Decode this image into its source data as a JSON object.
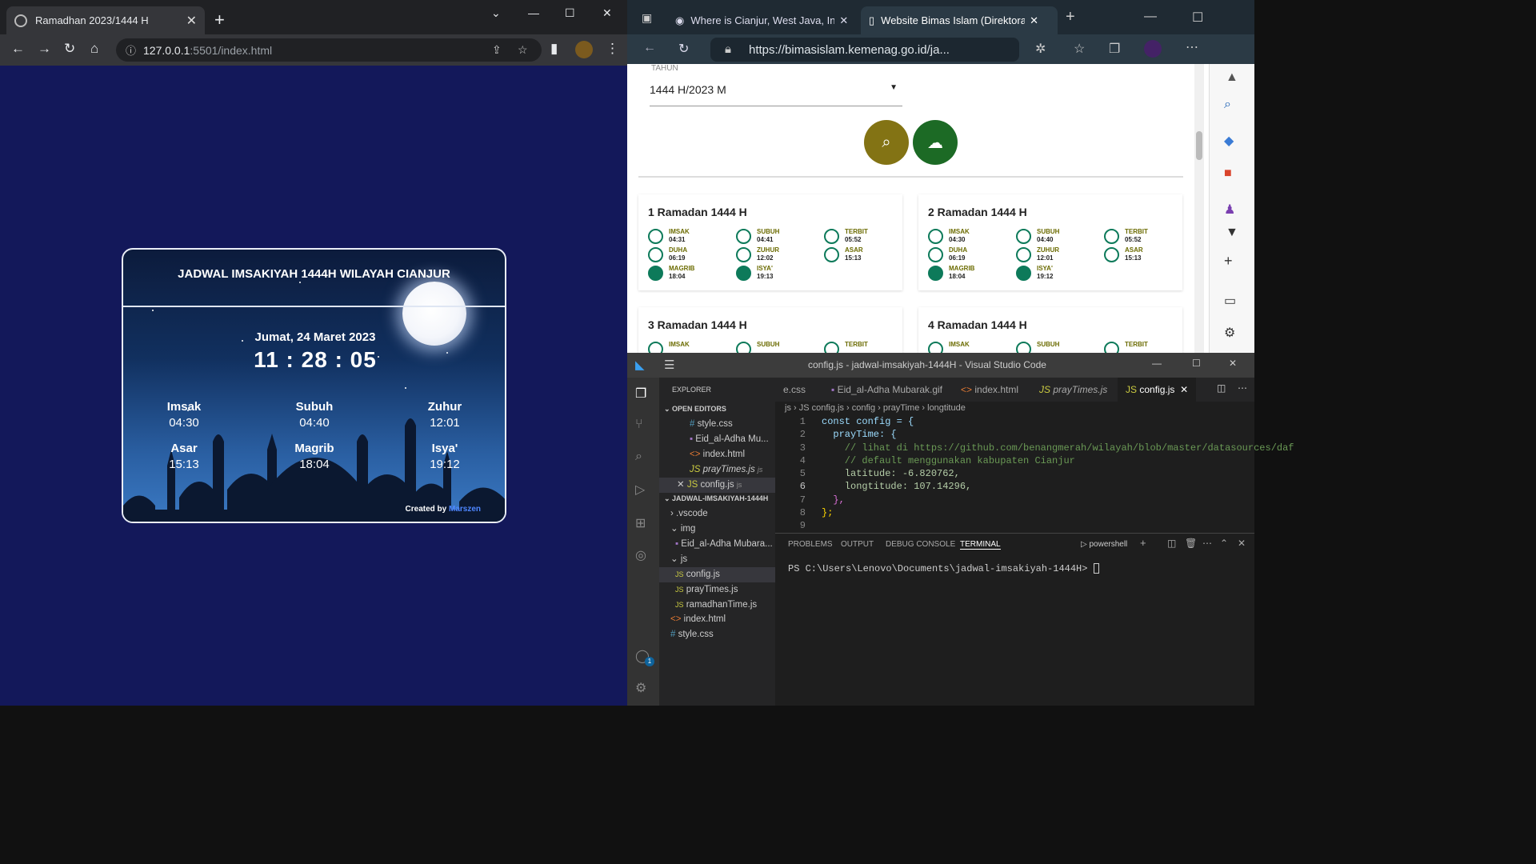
{
  "chrome": {
    "tab_title": "Ramadhan 2023/1444 H",
    "url_host": "127.0.0.1",
    "url_rest": ":5501/index.html"
  },
  "card": {
    "title": "JADWAL IMSAKIYAH 1444H WILAYAH CIANJUR",
    "date": "Jumat, 24 Maret 2023",
    "clock": "11 : 28 : 05",
    "prayers": [
      {
        "name": "Imsak",
        "time": "04:30"
      },
      {
        "name": "Subuh",
        "time": "04:40"
      },
      {
        "name": "Zuhur",
        "time": "12:01"
      },
      {
        "name": "Asar",
        "time": "15:13"
      },
      {
        "name": "Magrib",
        "time": "18:04"
      },
      {
        "name": "Isya'",
        "time": "19:12"
      }
    ],
    "credit_prefix": "Created by",
    "credit_author": "Marszen"
  },
  "edge": {
    "tab1": "Where is Cianjur, West Java, Indo",
    "tab2": "Website Bimas Islam (Direktorat",
    "url": "https://bimasislam.kemenag.go.id/ja...",
    "tahun_label": "TAHUN",
    "tahun_value": "1444 H/2023 M",
    "days": [
      {
        "title": "1 Ramadan 1444 H",
        "items": [
          {
            "n": "IMSAK",
            "t": "04:31"
          },
          {
            "n": "SUBUH",
            "t": "04:41"
          },
          {
            "n": "TERBIT",
            "t": "05:52"
          },
          {
            "n": "DUHA",
            "t": "06:19"
          },
          {
            "n": "ZUHUR",
            "t": "12:02"
          },
          {
            "n": "ASAR",
            "t": "15:13"
          },
          {
            "n": "MAGRIB",
            "t": "18:04"
          },
          {
            "n": "ISYA'",
            "t": "19:13"
          }
        ]
      },
      {
        "title": "2 Ramadan 1444 H",
        "items": [
          {
            "n": "IMSAK",
            "t": "04:30"
          },
          {
            "n": "SUBUH",
            "t": "04:40"
          },
          {
            "n": "TERBIT",
            "t": "05:52"
          },
          {
            "n": "DUHA",
            "t": "06:19"
          },
          {
            "n": "ZUHUR",
            "t": "12:01"
          },
          {
            "n": "ASAR",
            "t": "15:13"
          },
          {
            "n": "MAGRIB",
            "t": "18:04"
          },
          {
            "n": "ISYA'",
            "t": "19:12"
          }
        ]
      },
      {
        "title": "3 Ramadan 1444 H",
        "items": [
          {
            "n": "IMSAK",
            "t": ""
          },
          {
            "n": "SUBUH",
            "t": ""
          },
          {
            "n": "TERBIT",
            "t": ""
          }
        ]
      },
      {
        "title": "4 Ramadan 1444 H",
        "items": [
          {
            "n": "IMSAK",
            "t": ""
          },
          {
            "n": "SUBUH",
            "t": ""
          },
          {
            "n": "TERBIT",
            "t": ""
          }
        ]
      }
    ]
  },
  "vscode": {
    "title": "config.js - jadwal-imsakiyah-1444H - Visual Studio Code",
    "tabs": [
      "e.css",
      "Eid_al-Adha Mubarak.gif",
      "index.html",
      "prayTimes.js",
      "config.js"
    ],
    "breadcrumb": [
      "js",
      "JS config.js",
      "config",
      "prayTime",
      "longtitude"
    ],
    "explorer_title": "EXPLORER",
    "open_editors": "OPEN EDITORS",
    "open_files": [
      "style.css",
      "Eid_al-Adha Mu...",
      "index.html",
      "prayTimes.js",
      "config.js"
    ],
    "open_file_suffix": "js",
    "project": "JADWAL-IMSAKIYAH-1444H",
    "tree": [
      ".vscode",
      "img",
      "Eid_al-Adha Mubara...",
      "js",
      "config.js",
      "prayTimes.js",
      "ramadhanTime.js",
      "index.html",
      "style.css"
    ],
    "code": [
      "const config = {",
      "  prayTime: {",
      "    // lihat di https://github.com/benangmerah/wilayah/blob/master/datasources/daf",
      "    // default menggunakan kabupaten Cianjur",
      "    latitude: -6.820762,",
      "    longtitude: 107.14296,",
      "  },",
      "};",
      ""
    ],
    "panel_tabs": [
      "PROBLEMS",
      "OUTPUT",
      "DEBUG CONSOLE",
      "TERMINAL"
    ],
    "shell": "powershell",
    "prompt": "PS C:\\Users\\Lenovo\\Documents\\jadwal-imsakiyah-1444H> ",
    "badge": "1"
  }
}
